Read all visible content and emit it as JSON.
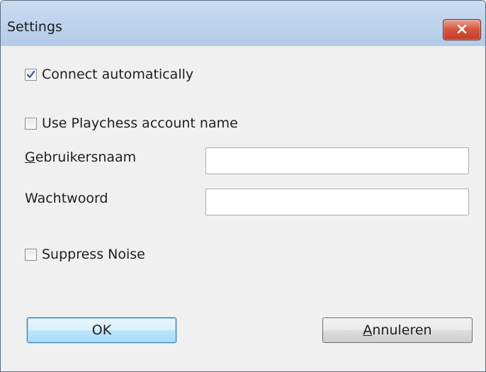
{
  "window": {
    "title": "Settings"
  },
  "options": {
    "connect_automatically": {
      "label": "Connect automatically",
      "checked": true
    },
    "use_playchess_account": {
      "label": "Use Playchess account name",
      "checked": false
    },
    "suppress_noise": {
      "label": "Suppress Noise",
      "checked": false
    }
  },
  "fields": {
    "username": {
      "label_mnemonic": "G",
      "label_rest": "ebruikersnaam",
      "value": ""
    },
    "password": {
      "label": "Wachtwoord",
      "value": ""
    }
  },
  "buttons": {
    "ok": "OK",
    "cancel_mnemonic": "A",
    "cancel_rest": "nnuleren"
  },
  "icons": {
    "close": "close-icon",
    "check": "check-icon"
  },
  "colors": {
    "close_button": "#c94a34",
    "default_button_border": "#3c7fb1",
    "title_bar": "#bfd4ee"
  }
}
